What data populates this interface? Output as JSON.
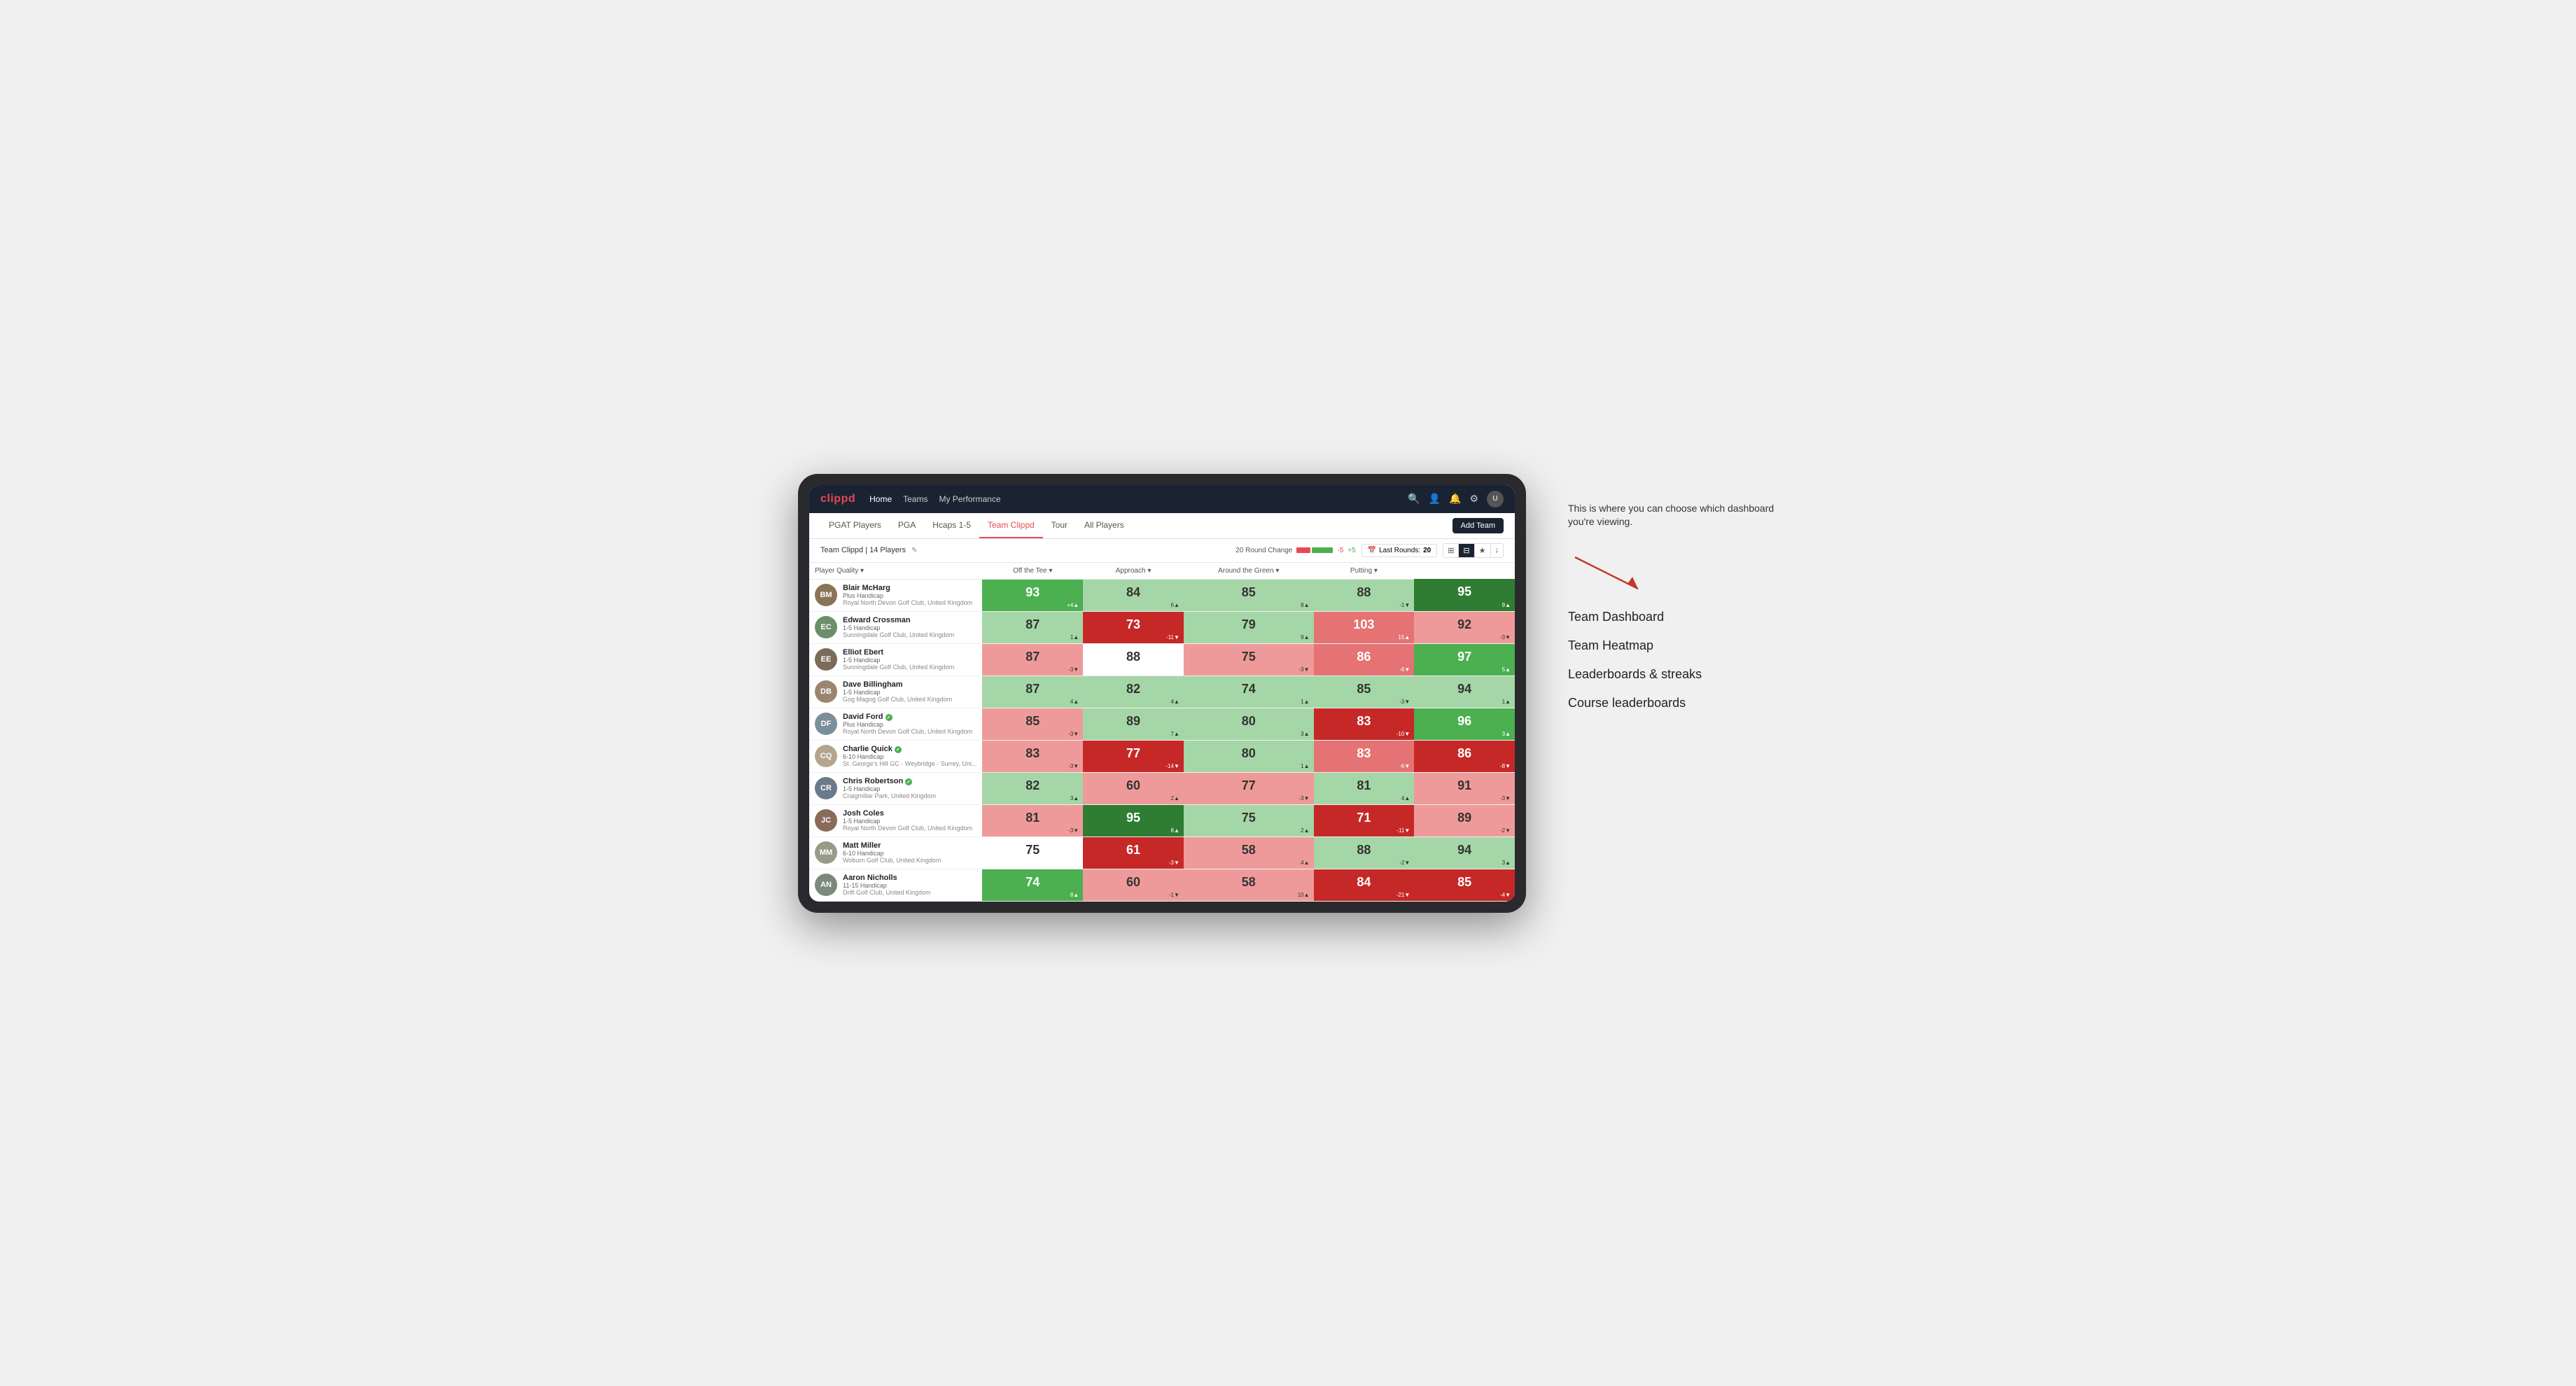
{
  "annotation": {
    "description": "This is where you can choose which dashboard you're viewing.",
    "items": [
      {
        "id": "team-dashboard",
        "label": "Team Dashboard"
      },
      {
        "id": "team-heatmap",
        "label": "Team Heatmap"
      },
      {
        "id": "leaderboards",
        "label": "Leaderboards & streaks"
      },
      {
        "id": "course-leaderboards",
        "label": "Course leaderboards"
      }
    ]
  },
  "nav": {
    "logo": "clippd",
    "links": [
      {
        "id": "home",
        "label": "Home",
        "active": true
      },
      {
        "id": "teams",
        "label": "Teams",
        "active": false
      },
      {
        "id": "my-performance",
        "label": "My Performance",
        "active": false
      }
    ]
  },
  "sub_nav": {
    "links": [
      {
        "id": "pgat",
        "label": "PGAT Players",
        "active": false
      },
      {
        "id": "pga",
        "label": "PGA",
        "active": false
      },
      {
        "id": "hcaps",
        "label": "Hcaps 1-5",
        "active": false
      },
      {
        "id": "team-clippd",
        "label": "Team Clippd",
        "active": true
      },
      {
        "id": "tour",
        "label": "Tour",
        "active": false
      },
      {
        "id": "all-players",
        "label": "All Players",
        "active": false
      }
    ],
    "add_team_label": "Add Team"
  },
  "team_header": {
    "team_name": "Team Clippd | 14 Players",
    "round_change_label": "20 Round Change",
    "change_negative": "-5",
    "change_positive": "+5",
    "last_rounds_label": "Last Rounds:",
    "last_rounds_count": "20"
  },
  "table": {
    "columns": [
      {
        "id": "player",
        "label": "Player Quality ▾"
      },
      {
        "id": "off-tee",
        "label": "Off the Tee ▾"
      },
      {
        "id": "approach",
        "label": "Approach ▾"
      },
      {
        "id": "around-green",
        "label": "Around the Green ▾"
      },
      {
        "id": "putting",
        "label": "Putting ▾"
      }
    ],
    "players": [
      {
        "id": "blair-mcharg",
        "name": "Blair McHarg",
        "handicap": "Plus Handicap",
        "club": "Royal North Devon Golf Club, United Kingdom",
        "avatar_initials": "BM",
        "avatar_color": "#8B7355",
        "verified": false,
        "scores": [
          {
            "value": 93,
            "change": "+4",
            "direction": "up",
            "bg": "bg-green-med"
          },
          {
            "value": 84,
            "change": "6",
            "direction": "up",
            "bg": "bg-green-light"
          },
          {
            "value": 85,
            "change": "8",
            "direction": "up",
            "bg": "bg-green-light"
          },
          {
            "value": 88,
            "change": "-1",
            "direction": "down",
            "bg": "bg-green-light"
          },
          {
            "value": 95,
            "change": "9",
            "direction": "up",
            "bg": "bg-green-dark"
          }
        ]
      },
      {
        "id": "edward-crossman",
        "name": "Edward Crossman",
        "handicap": "1-5 Handicap",
        "club": "Sunningdale Golf Club, United Kingdom",
        "avatar_initials": "EC",
        "avatar_color": "#6B8E6B",
        "verified": false,
        "scores": [
          {
            "value": 87,
            "change": "1",
            "direction": "up",
            "bg": "bg-green-light"
          },
          {
            "value": 73,
            "change": "-11",
            "direction": "down",
            "bg": "bg-red-dark"
          },
          {
            "value": 79,
            "change": "9",
            "direction": "up",
            "bg": "bg-green-light"
          },
          {
            "value": 103,
            "change": "15",
            "direction": "up",
            "bg": "bg-red-med"
          },
          {
            "value": 92,
            "change": "-3",
            "direction": "down",
            "bg": "bg-red-light"
          }
        ]
      },
      {
        "id": "elliot-ebert",
        "name": "Elliot Ebert",
        "handicap": "1-5 Handicap",
        "club": "Sunningdale Golf Club, United Kingdom",
        "avatar_initials": "EE",
        "avatar_color": "#7A6B5A",
        "verified": false,
        "scores": [
          {
            "value": 87,
            "change": "-3",
            "direction": "down",
            "bg": "bg-red-light"
          },
          {
            "value": 88,
            "change": "",
            "direction": "",
            "bg": "bg-white"
          },
          {
            "value": 75,
            "change": "-3",
            "direction": "down",
            "bg": "bg-red-light"
          },
          {
            "value": 86,
            "change": "-6",
            "direction": "down",
            "bg": "bg-red-med"
          },
          {
            "value": 97,
            "change": "5",
            "direction": "up",
            "bg": "bg-green-med"
          }
        ]
      },
      {
        "id": "dave-billingham",
        "name": "Dave Billingham",
        "handicap": "1-5 Handicap",
        "club": "Gog Magog Golf Club, United Kingdom",
        "avatar_initials": "DB",
        "avatar_color": "#9A8570",
        "verified": false,
        "scores": [
          {
            "value": 87,
            "change": "4",
            "direction": "up",
            "bg": "bg-green-light"
          },
          {
            "value": 82,
            "change": "4",
            "direction": "up",
            "bg": "bg-green-light"
          },
          {
            "value": 74,
            "change": "1",
            "direction": "up",
            "bg": "bg-green-light"
          },
          {
            "value": 85,
            "change": "-3",
            "direction": "down",
            "bg": "bg-green-light"
          },
          {
            "value": 94,
            "change": "1",
            "direction": "up",
            "bg": "bg-green-light"
          }
        ]
      },
      {
        "id": "david-ford",
        "name": "David Ford",
        "handicap": "Plus Handicap",
        "club": "Royal North Devon Golf Club, United Kingdom",
        "avatar_initials": "DF",
        "avatar_color": "#7A8F9A",
        "verified": true,
        "scores": [
          {
            "value": 85,
            "change": "-3",
            "direction": "down",
            "bg": "bg-red-light"
          },
          {
            "value": 89,
            "change": "7",
            "direction": "up",
            "bg": "bg-green-light"
          },
          {
            "value": 80,
            "change": "3",
            "direction": "up",
            "bg": "bg-green-light"
          },
          {
            "value": 83,
            "change": "-10",
            "direction": "down",
            "bg": "bg-red-dark"
          },
          {
            "value": 96,
            "change": "3",
            "direction": "up",
            "bg": "bg-green-med"
          }
        ]
      },
      {
        "id": "charlie-quick",
        "name": "Charlie Quick",
        "handicap": "6-10 Handicap",
        "club": "St. George's Hill GC - Weybridge - Surrey, Uni...",
        "avatar_initials": "CQ",
        "avatar_color": "#B5A590",
        "verified": true,
        "scores": [
          {
            "value": 83,
            "change": "-3",
            "direction": "down",
            "bg": "bg-red-light"
          },
          {
            "value": 77,
            "change": "-14",
            "direction": "down",
            "bg": "bg-red-dark"
          },
          {
            "value": 80,
            "change": "1",
            "direction": "up",
            "bg": "bg-green-light"
          },
          {
            "value": 83,
            "change": "-6",
            "direction": "down",
            "bg": "bg-red-med"
          },
          {
            "value": 86,
            "change": "-8",
            "direction": "down",
            "bg": "bg-red-dark"
          }
        ]
      },
      {
        "id": "chris-robertson",
        "name": "Chris Robertson",
        "handicap": "1-5 Handicap",
        "club": "Craigmillar Park, United Kingdom",
        "avatar_initials": "CR",
        "avatar_color": "#6A7A8A",
        "verified": true,
        "scores": [
          {
            "value": 82,
            "change": "3",
            "direction": "up",
            "bg": "bg-green-light"
          },
          {
            "value": 60,
            "change": "2",
            "direction": "up",
            "bg": "bg-red-light"
          },
          {
            "value": 77,
            "change": "-3",
            "direction": "down",
            "bg": "bg-red-light"
          },
          {
            "value": 81,
            "change": "4",
            "direction": "up",
            "bg": "bg-green-light"
          },
          {
            "value": 91,
            "change": "-3",
            "direction": "down",
            "bg": "bg-red-light"
          }
        ]
      },
      {
        "id": "josh-coles",
        "name": "Josh Coles",
        "handicap": "1-5 Handicap",
        "club": "Royal North Devon Golf Club, United Kingdom",
        "avatar_initials": "JC",
        "avatar_color": "#8A6A5A",
        "verified": false,
        "scores": [
          {
            "value": 81,
            "change": "-3",
            "direction": "down",
            "bg": "bg-red-light"
          },
          {
            "value": 95,
            "change": "8",
            "direction": "up",
            "bg": "bg-green-dark"
          },
          {
            "value": 75,
            "change": "2",
            "direction": "up",
            "bg": "bg-green-light"
          },
          {
            "value": 71,
            "change": "-11",
            "direction": "down",
            "bg": "bg-red-dark"
          },
          {
            "value": 89,
            "change": "-2",
            "direction": "down",
            "bg": "bg-red-light"
          }
        ]
      },
      {
        "id": "matt-miller",
        "name": "Matt Miller",
        "handicap": "6-10 Handicap",
        "club": "Woburn Golf Club, United Kingdom",
        "avatar_initials": "MM",
        "avatar_color": "#9A9A8A",
        "verified": false,
        "scores": [
          {
            "value": 75,
            "change": "",
            "direction": "",
            "bg": "bg-white"
          },
          {
            "value": 61,
            "change": "-3",
            "direction": "down",
            "bg": "bg-red-dark"
          },
          {
            "value": 58,
            "change": "4",
            "direction": "up",
            "bg": "bg-red-light"
          },
          {
            "value": 88,
            "change": "-2",
            "direction": "down",
            "bg": "bg-green-light"
          },
          {
            "value": 94,
            "change": "3",
            "direction": "up",
            "bg": "bg-green-light"
          }
        ]
      },
      {
        "id": "aaron-nicholls",
        "name": "Aaron Nicholls",
        "handicap": "11-15 Handicap",
        "club": "Drift Golf Club, United Kingdom",
        "avatar_initials": "AN",
        "avatar_color": "#7A8A7A",
        "verified": false,
        "scores": [
          {
            "value": 74,
            "change": "8",
            "direction": "up",
            "bg": "bg-green-med"
          },
          {
            "value": 60,
            "change": "-1",
            "direction": "down",
            "bg": "bg-red-light"
          },
          {
            "value": 58,
            "change": "10",
            "direction": "up",
            "bg": "bg-red-light"
          },
          {
            "value": 84,
            "change": "-21",
            "direction": "down",
            "bg": "bg-red-dark"
          },
          {
            "value": 85,
            "change": "-4",
            "direction": "down",
            "bg": "bg-red-dark"
          }
        ]
      }
    ]
  }
}
